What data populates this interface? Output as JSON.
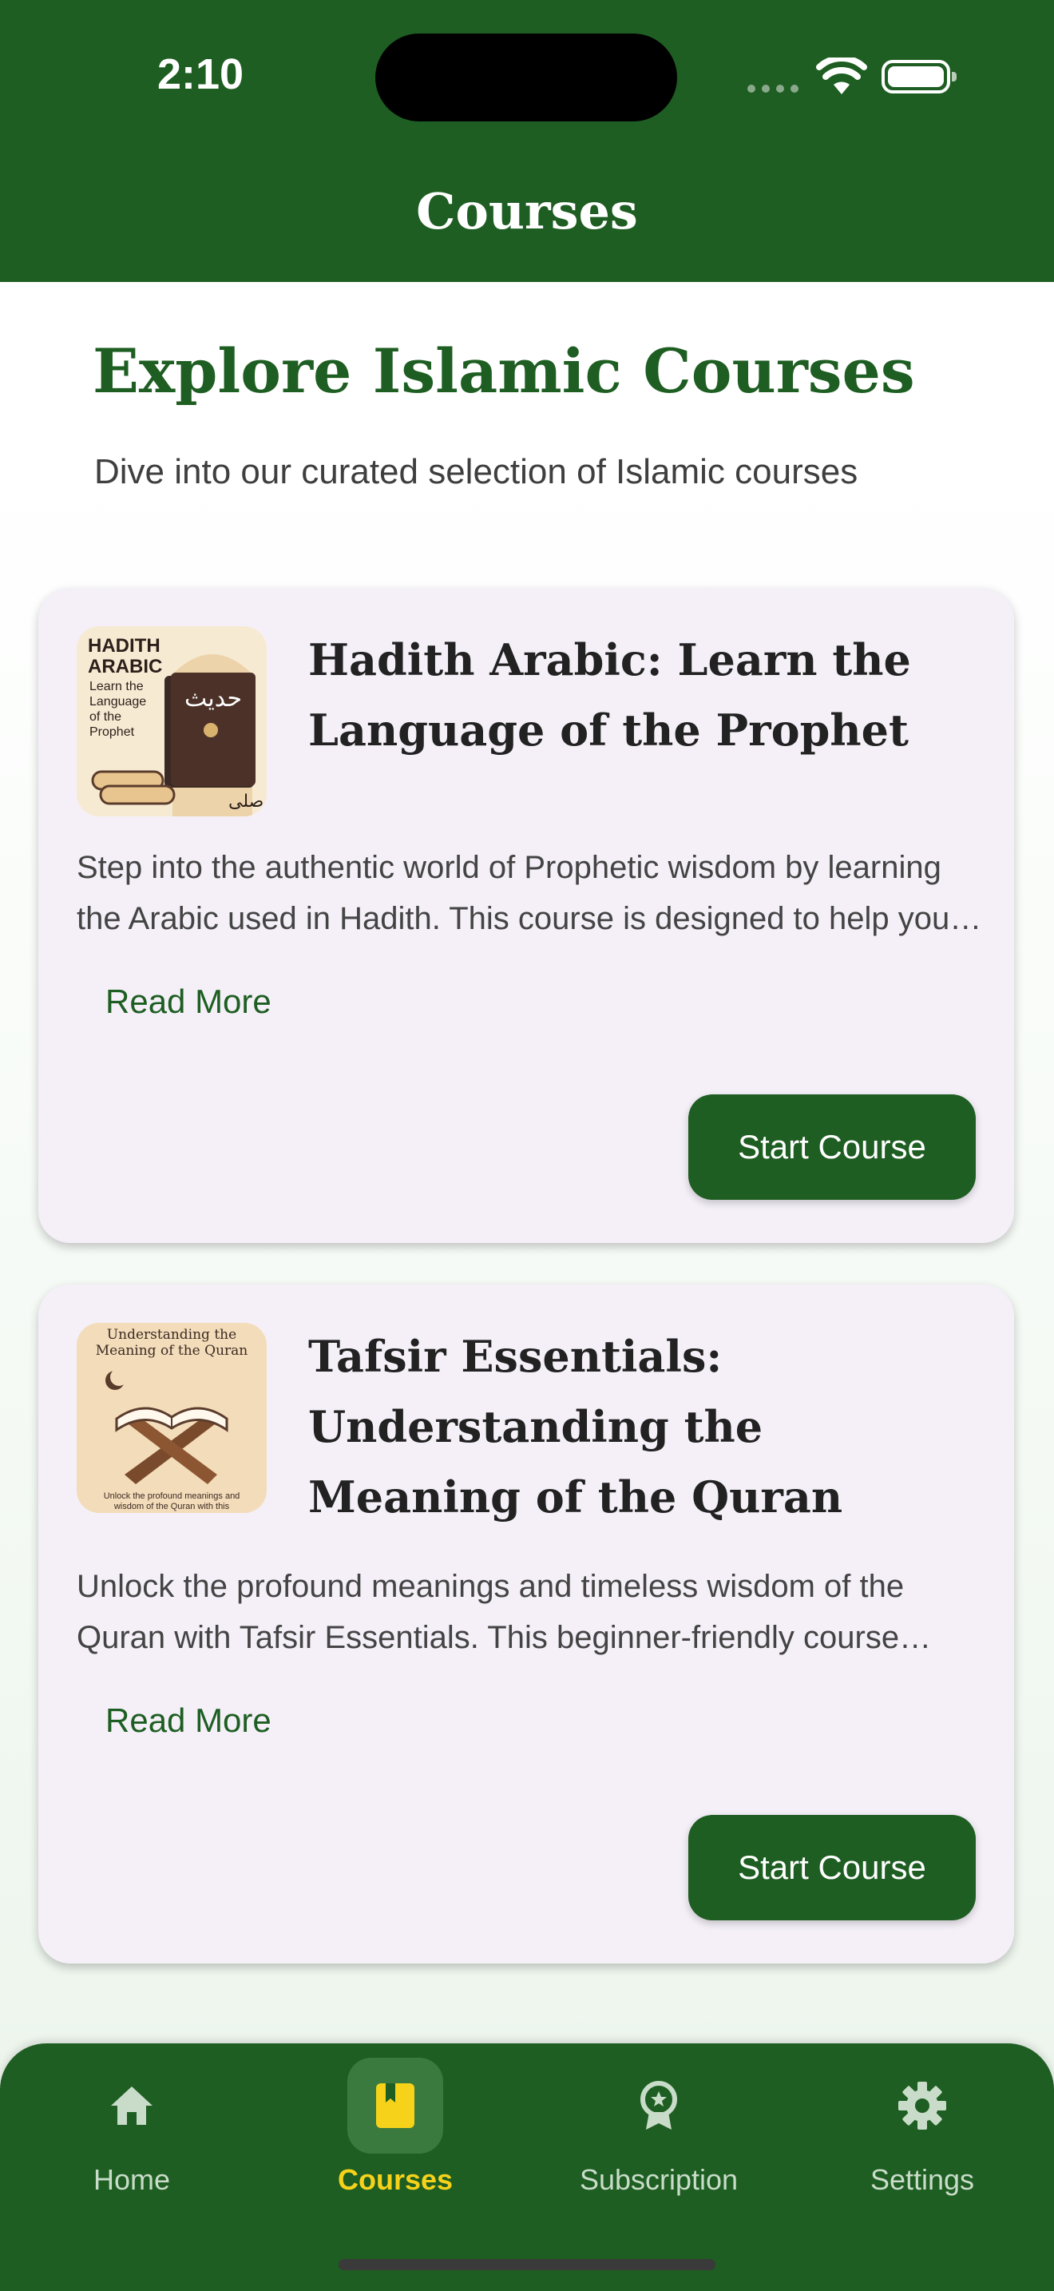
{
  "status_bar": {
    "time": "2:10"
  },
  "header": {
    "title": "Courses"
  },
  "intro": {
    "title": "Explore Islamic Courses",
    "subtitle": "Dive into our curated selection of Islamic courses"
  },
  "courses": [
    {
      "title": "Hadith Arabic: Learn the Language of the Prophet",
      "description": "Step into the authentic world of Prophetic wisdom by learning the Arabic used in Hadith. This course is designed to help you understand the words of the Prophet directly.",
      "read_more": "Read More",
      "start_label": "Start Course",
      "thumbnail": {
        "line1": "HADITH",
        "line2": "ARABIC",
        "line3": "Learn the",
        "line4": "Language",
        "line5": "of the",
        "line6": "Prophet",
        "arabic": "حديث",
        "seal": "صلى"
      }
    },
    {
      "title": "Tafsir Essentials: Understanding the Meaning of the Quran",
      "description": "Unlock the profound meanings and timeless wisdom of the Quran with Tafsir Essentials. This beginner-friendly course introduces you to classical interpretation.",
      "read_more": "Read More",
      "start_label": "Start Course",
      "thumbnail": {
        "heading1": "Understanding the",
        "heading2": "Meaning of the Quran",
        "caption1": "Unlock the profound meanings and",
        "caption2": "wisdom of the Quran with this"
      }
    }
  ],
  "bottom_nav": [
    {
      "label": "Home",
      "icon": "home-icon",
      "active": false
    },
    {
      "label": "Courses",
      "icon": "book-icon",
      "active": true
    },
    {
      "label": "Subscription",
      "icon": "award-icon",
      "active": false
    },
    {
      "label": "Settings",
      "icon": "gear-icon",
      "active": false
    }
  ],
  "colors": {
    "primary": "#1e5e22",
    "active_nav": "#f6d21a",
    "card_bg": "#f5f0f8"
  }
}
